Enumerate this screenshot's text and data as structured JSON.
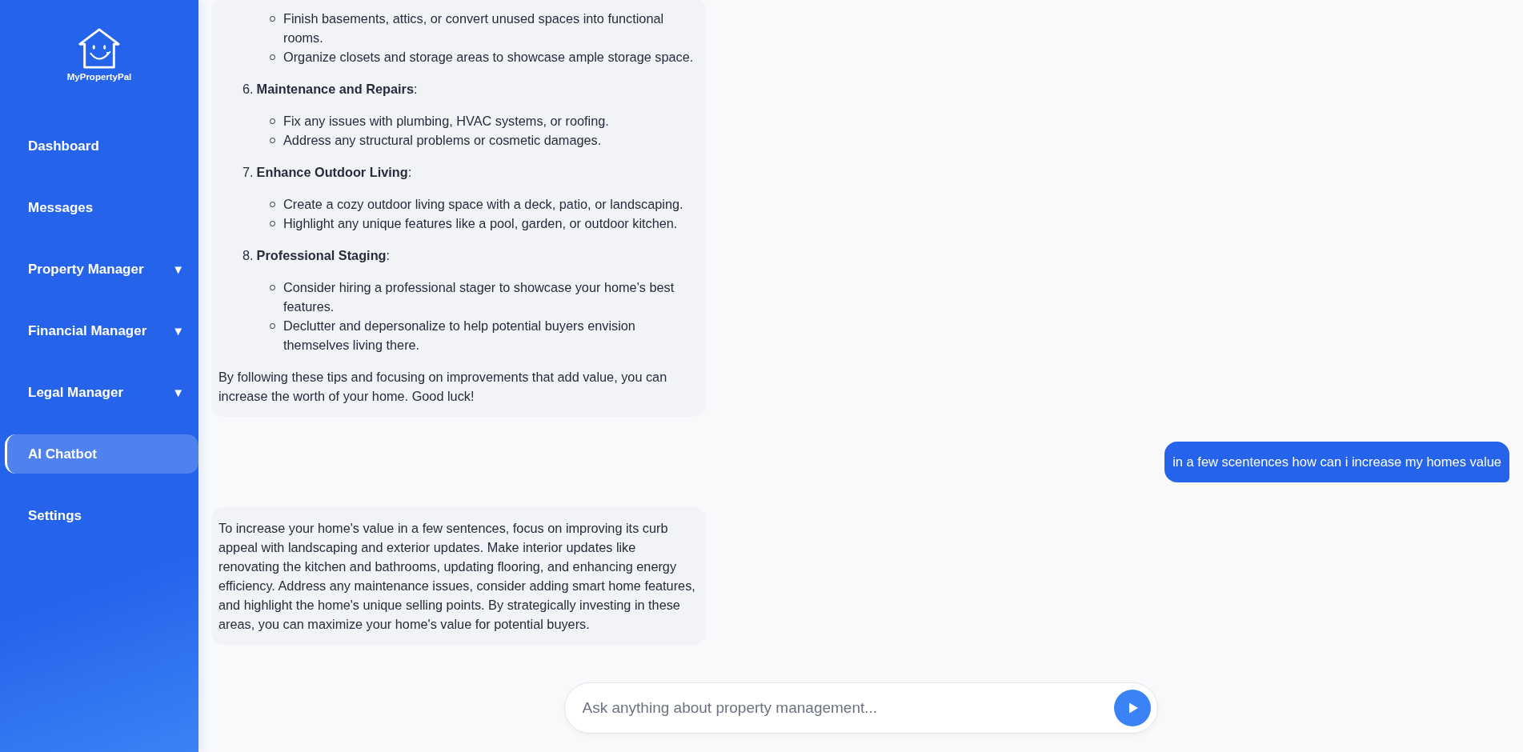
{
  "sidebar": {
    "logo": {
      "name": "MyPropertyPal"
    },
    "items": [
      {
        "label": "Dashboard",
        "selected": false
      },
      {
        "label": "Messages",
        "selected": false
      },
      {
        "label": "Property Manager",
        "selected": false,
        "caret": "▼"
      },
      {
        "label": "Financial Manager",
        "selected": false,
        "caret": "▼"
      },
      {
        "label": "Legal Manager",
        "selected": false,
        "caret": "▼"
      },
      {
        "label": "AI Chatbot",
        "selected": true
      },
      {
        "label": "Settings",
        "selected": false
      }
    ]
  },
  "messages": [
    {
      "kind": "bot",
      "blocks": [
        {
          "kind": "bullets",
          "items": [
            "Finish basements, attics, or convert unused spaces into functional rooms.",
            "Organize closets and storage areas to showcase ample storage space."
          ]
        },
        {
          "kind": "numbered",
          "number": "6.",
          "text": "**Maintenance and Repairs**:",
          "items": [
            "Fix any issues with plumbing, HVAC systems, or roofing.",
            "Address any structural problems or cosmetic damages."
          ]
        },
        {
          "kind": "numbered",
          "number": "7.",
          "text": "**Enhance Outdoor Living**:",
          "items": [
            "Create a cozy outdoor living space with a deck, patio, or landscaping.",
            "Highlight any unique features like a pool, garden, or outdoor kitchen."
          ]
        },
        {
          "kind": "numbered",
          "number": "8.",
          "text": "**Professional Staging**:",
          "items": [
            "Consider hiring a professional stager to showcase your home's best features.",
            "Declutter and depersonalize to help potential buyers envision themselves living there."
          ]
        },
        {
          "kind": "paragraph",
          "text": "By following these tips and focusing on improvements that add value, you can increase the worth of your home. Good luck!"
        }
      ]
    },
    {
      "kind": "user",
      "text": "in a few scentences how can i increase my homes value"
    },
    {
      "kind": "bot",
      "blocks": [
        {
          "kind": "paragraph",
          "text": "To increase your home's value in a few sentences, focus on improving its curb appeal with landscaping and exterior updates. Make interior updates like renovating the kitchen and bathrooms, updating flooring, and enhancing energy efficiency. Address any maintenance issues, consider adding smart home features, and highlight the home's unique selling points. By strategically investing in these areas, you can maximize your home's value for potential buyers."
        }
      ]
    }
  ],
  "input": {
    "placeholder": "Ask anything about property management..."
  }
}
